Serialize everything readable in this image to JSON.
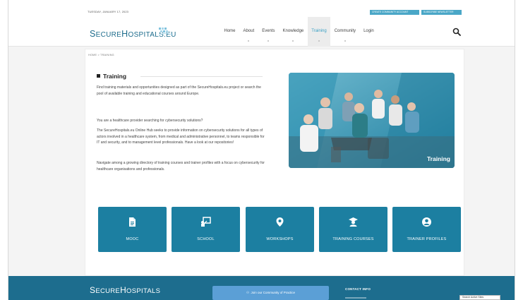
{
  "topbar": {
    "date": "TUESDAY, JANUARY 17, 2023",
    "create_account_label": "CREATE COMMUNITY ACCOUNT",
    "newsletter_label": "SUBSCRIBE NEWSLETTER"
  },
  "header": {
    "logo_part1": "S",
    "logo_part2": "ECURE",
    "logo_part3": "H",
    "logo_part4": "OSPITALS.EU",
    "nav": [
      {
        "label": "Home",
        "active": false
      },
      {
        "label": "About",
        "active": false
      },
      {
        "label": "Events",
        "active": false
      },
      {
        "label": "Knowledge",
        "active": false
      },
      {
        "label": "Training",
        "active": true
      },
      {
        "label": "Community",
        "active": false
      },
      {
        "label": "Login",
        "active": false
      }
    ]
  },
  "breadcrumb": "HOME  >  TRAINING",
  "main": {
    "title": "Training",
    "p1": "Find training materials and opportunities designed as part of the SecureHospitals.eu project or search the pool of available training and educational courses around Europe.",
    "p2": "You are a healthcare provider searching for cybersecurity solutions?",
    "p3": "The SecureHospitals.eu Online Hub seeks to provide information on cybersecurity solutions for all types of actors involved in a healthcare system, from medical and administrative personnel, to teams responsible for IT and security, and to management level professionals. Have a look at our repositories!",
    "p4": "Navigate among a growing directory of training courses and trainer profiles with a focus on cybersecurity for healthcare organisations and professionals.",
    "hero_caption": "Training"
  },
  "cards": [
    {
      "label": "MOOC",
      "icon": "document-icon"
    },
    {
      "label": "SCHOOL",
      "icon": "presentation-icon"
    },
    {
      "label": "WORKSHOPS",
      "icon": "map-pin-icon"
    },
    {
      "label": "TRAINING COURSES",
      "icon": "graduate-icon"
    },
    {
      "label": "TRAINER PROFILES",
      "icon": "user-circle-icon"
    }
  ],
  "footer": {
    "logo_part1": "S",
    "logo_part2": "ECURE",
    "logo_part3": "H",
    "logo_part4": "OSPITALS",
    "cta_label": "Join our Community of Practice",
    "contact_heading": "CONTACT INFO",
    "tooltip": "Search Active Sites"
  },
  "colors": {
    "brand": "#1d6c8c",
    "accent": "#3aa0c4",
    "card": "#1c7fa1",
    "footer": "#1d6d8e",
    "cta": "#5b9fd6"
  }
}
